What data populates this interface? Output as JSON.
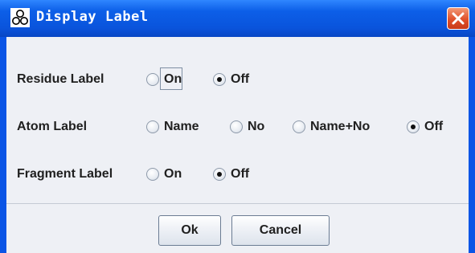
{
  "window": {
    "title": "Display Label",
    "app_icon": "molecule-icon",
    "close_icon": "close-icon"
  },
  "rows": [
    {
      "label": "Residue Label",
      "options": [
        {
          "label": "On",
          "selected": false,
          "focused": true
        },
        {
          "label": "Off",
          "selected": true,
          "focused": false
        }
      ]
    },
    {
      "label": "Atom Label",
      "options": [
        {
          "label": "Name",
          "selected": false
        },
        {
          "label": "No",
          "selected": false
        },
        {
          "label": "Name+No",
          "selected": false
        },
        {
          "label": "Off",
          "selected": true
        }
      ]
    },
    {
      "label": "Fragment Label",
      "options": [
        {
          "label": "On",
          "selected": false
        },
        {
          "label": "Off",
          "selected": true
        }
      ]
    }
  ],
  "buttons": {
    "ok": "Ok",
    "cancel": "Cancel"
  },
  "colors": {
    "titlebar": "#0a55e6",
    "client_bg": "#eef0f5",
    "close_button": "#e0502a"
  }
}
